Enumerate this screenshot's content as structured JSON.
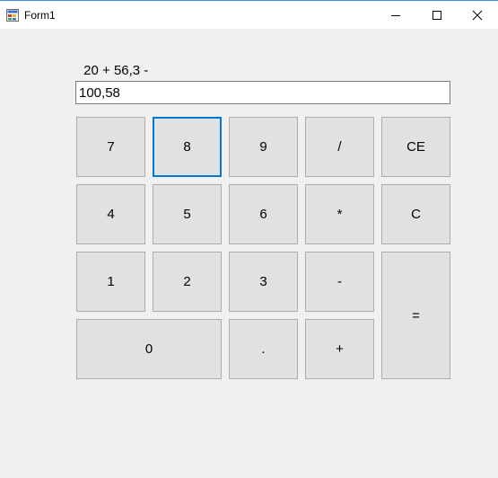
{
  "window": {
    "title": "Form1"
  },
  "calculator": {
    "expression": " 20 + 56,3 -",
    "display_value": "100,58",
    "keys": {
      "k7": "7",
      "k8": "8",
      "k9": "9",
      "divide": "/",
      "ce": "CE",
      "k4": "4",
      "k5": "5",
      "k6": "6",
      "multiply": "*",
      "clear": "C",
      "k1": "1",
      "k2": "2",
      "k3": "3",
      "minus": "-",
      "equals": "=",
      "k0": "0",
      "decimal": ".",
      "plus": "+"
    }
  },
  "colors": {
    "focus_accent": "#0078d7",
    "button_face": "#e1e1e1",
    "window_background": "#f0f0f0"
  }
}
